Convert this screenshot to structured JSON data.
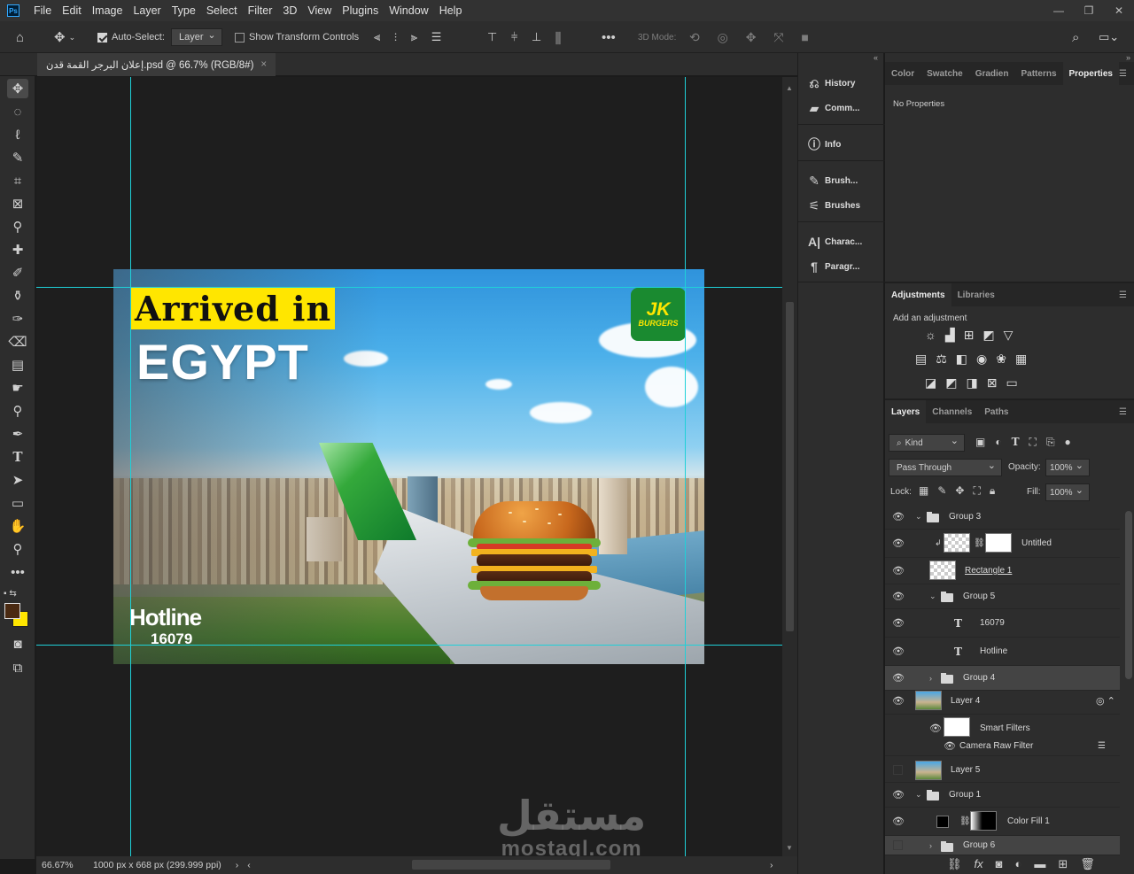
{
  "menu": [
    "File",
    "Edit",
    "Image",
    "Layer",
    "Type",
    "Select",
    "Filter",
    "3D",
    "View",
    "Plugins",
    "Window",
    "Help"
  ],
  "app_logo": "Ps",
  "options": {
    "auto_select_label": "Auto-Select:",
    "auto_select_value": "Layer",
    "show_transform_label": "Show Transform Controls",
    "mode_3d_label": "3D Mode:"
  },
  "document_tab": {
    "title": "إعلان البرجر القمة قدن.psd @ 66.7% (RGB/8#)"
  },
  "artwork": {
    "headline": "Arrived in",
    "country": "EGYPT",
    "hotline_label": "Hotline",
    "hotline_number": "16079",
    "logo_mark": "JK",
    "logo_text": "BURGERS"
  },
  "watermark": {
    "arabic": "مستقل",
    "latin": "mostaql.com"
  },
  "status": {
    "zoom": "66.67%",
    "doc_info": "1000 px x 668 px (299.999 ppi)"
  },
  "dock": [
    {
      "label": "History",
      "icon": "history-icon"
    },
    {
      "label": "Comm...",
      "icon": "comments-icon"
    },
    {
      "label": "Info",
      "icon": "info-icon"
    },
    {
      "label": "Brush...",
      "icon": "brush-settings-icon"
    },
    {
      "label": "Brushes",
      "icon": "brushes-icon"
    },
    {
      "label": "Charac...",
      "icon": "character-icon"
    },
    {
      "label": "Paragr...",
      "icon": "paragraph-icon"
    }
  ],
  "properties_panel": {
    "tabs": [
      "Color",
      "Swatche",
      "Gradien",
      "Patterns",
      "Properties"
    ],
    "active_tab": "Properties",
    "message": "No Properties"
  },
  "adjustments_panel": {
    "tabs": [
      "Adjustments",
      "Libraries"
    ],
    "hint": "Add an adjustment"
  },
  "layers_panel": {
    "tabs": [
      "Layers",
      "Channels",
      "Paths"
    ],
    "filter_kind": "Kind",
    "blend_mode": "Pass Through",
    "opacity_label": "Opacity:",
    "opacity_value": "100%",
    "lock_label": "Lock:",
    "fill_label": "Fill:",
    "fill_value": "100%",
    "layers": [
      {
        "name": "Group 3",
        "type": "group"
      },
      {
        "name": "Untitled",
        "type": "smart"
      },
      {
        "name": "Rectangle 1",
        "type": "shape"
      },
      {
        "name": "Group 5",
        "type": "group"
      },
      {
        "name": "16079",
        "type": "text"
      },
      {
        "name": "Hotline",
        "type": "text"
      },
      {
        "name": "Group 4",
        "type": "group"
      },
      {
        "name": "Layer 4",
        "type": "image"
      },
      {
        "name": "Smart Filters",
        "type": "smart-filter"
      },
      {
        "name": "Camera Raw Filter",
        "type": "filter"
      },
      {
        "name": "Layer 5",
        "type": "image"
      },
      {
        "name": "Group 1",
        "type": "group"
      },
      {
        "name": "Color Fill 1",
        "type": "fill"
      },
      {
        "name": "Group 6",
        "type": "group"
      }
    ]
  },
  "colors": {
    "foreground": "#4a2a12",
    "background": "#ffe600",
    "guide": "#1fd0d8"
  }
}
